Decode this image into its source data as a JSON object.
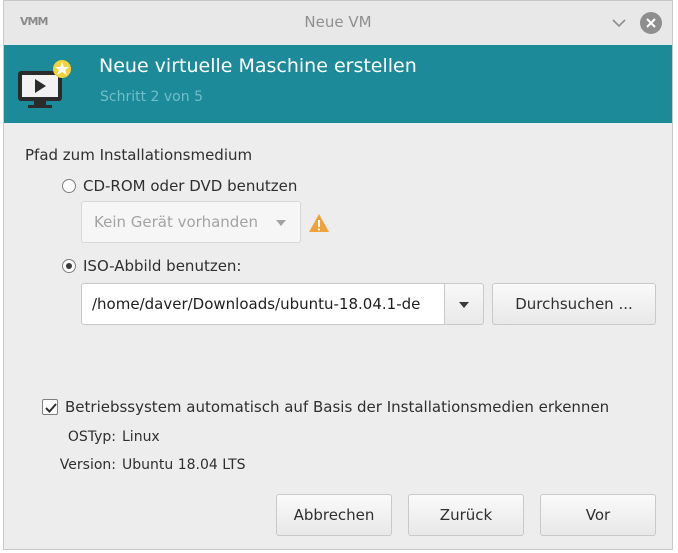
{
  "window": {
    "app_logo": "VMM",
    "title": "Neue VM"
  },
  "banner": {
    "title": "Neue virtuelle Maschine erstellen",
    "step": "Schritt 2 von 5"
  },
  "form": {
    "section_label": "Pfad zum Installationsmedium",
    "cdrom_label": "CD-ROM oder DVD benutzen",
    "cdrom_selected": false,
    "cdrom_device_value": "Kein Gerät vorhanden",
    "iso_label": "ISO-Abbild benutzen:",
    "iso_selected": true,
    "iso_path_value": "/home/daver/Downloads/ubuntu-18.04.1-de",
    "browse_label": "Durchsuchen ...",
    "autodetect_label": "Betriebssystem automatisch auf Basis der Installationsmedien erkennen",
    "autodetect_checked": true,
    "ostype_key": "OSTyp:",
    "ostype_value": "Linux",
    "version_key": "Version:",
    "version_value": "Ubuntu 18.04 LTS"
  },
  "buttons": {
    "cancel": "Abbrechen",
    "back": "Zurück",
    "forward": "Vor"
  },
  "colors": {
    "banner": "#1d8a99",
    "warning": "#f0a23a"
  },
  "icons": {
    "titlebar": [
      "chevron-down-icon",
      "close-icon"
    ],
    "banner": "new-vm-icon",
    "warning": "warning-icon",
    "check": "checkmark-icon"
  }
}
